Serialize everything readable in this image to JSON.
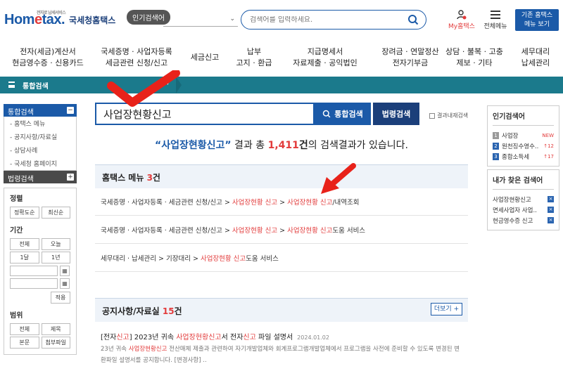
{
  "header": {
    "logo_text_left": "Hom",
    "logo_text_e": "e",
    "logo_text_right": "tax.",
    "logo_sub": "전자로 납세서비스",
    "logo_kr": "국세청홈택스",
    "hot_label": "인기검색어",
    "search_placeholder": "검색어를 입력하세요.",
    "my_hometax": "My홈택스",
    "all_menu": "전체메뉴",
    "old_home": "기존 홈택스\n메뉴 보기"
  },
  "gnb": [
    {
      "label": "전자(세금)계산서\n현금영수증 · 신용카드"
    },
    {
      "label": "국세증명 · 사업자등록\n세금관련 신청/신고"
    },
    {
      "label": "세금신고"
    },
    {
      "label": "납부\n고지 · 환급"
    },
    {
      "label": "지급명세서\n자료제출 · 공익법인"
    },
    {
      "label": "장려금 · 연말정산\n전자기부금"
    },
    {
      "label": "상담 · 불복 · 고충\n제보 · 기타"
    },
    {
      "label": "세무대리\n납세관리"
    }
  ],
  "navbar": {
    "crumb": "통합검색",
    "drop": "▾"
  },
  "sidebar": {
    "head1": "통합검색",
    "items": [
      "- 홈택스 메뉴",
      "- 공지사항/자료실",
      "- 상담사례",
      "- 국세청 홈페이지"
    ],
    "head2": "법령검색",
    "sort_title": "정렬",
    "sort_buttons": [
      "정확도순",
      "최신순"
    ],
    "period_title": "기간",
    "period_buttons": [
      "전체",
      "오늘",
      "1달",
      "1년"
    ],
    "apply": "적용",
    "scope_title": "범위",
    "scope_buttons": [
      "전체",
      "제목",
      "본문",
      "첨부파일"
    ]
  },
  "search": {
    "value": "사업장현황신고",
    "total_button": "통합검색",
    "law_button": "법령검색",
    "within_label": "결과내재검색"
  },
  "result": {
    "open_q": "“",
    "keyword": "사업장현황신고",
    "close_q": "”",
    "mid": " 결과 총 ",
    "count": "1,411",
    "unit": "건",
    "tail": "의 검색결과가 있습니다."
  },
  "menu_section": {
    "title": "홈택스 메뉴 ",
    "count": "3",
    "unit": "건",
    "rows": [
      {
        "pre": "국세증명 · 사업자등록 · 세금관련 신청/신고 > ",
        "hl1": "사업장현황 신고",
        "mid": " > ",
        "hl2": "사업장현황 신고",
        "post": "/내역조회"
      },
      {
        "pre": "국세증명 · 사업자등록 · 세금관련 신청/신고 > ",
        "hl1": "사업장현황 신고",
        "mid": " > ",
        "hl2": "사업장현황 신고",
        "post": "도움 서비스"
      },
      {
        "pre": "세무대리 · 납세관리 > 기장대리 > ",
        "hl1": "사업장현황 신고",
        "mid": "",
        "hl2": "",
        "post": "도움 서비스"
      }
    ]
  },
  "notice_section": {
    "title": "공지사항/자료실 ",
    "count": "15",
    "unit": "건",
    "more": "더보기 +",
    "item_pre": "[전자",
    "item_hl1": "신고",
    "item_mid": "] 2023년 귀속 ",
    "item_hl2": "사업장현황신고",
    "item_mid2": "서 전자",
    "item_hl3": "신고",
    "item_post": " 파일 설명서",
    "item_date": "2024.01.02",
    "body_pre": "23년 귀속 ",
    "body_hl": "사업장현황신고",
    "body_post": " 전산매체 제출과 관련하여 자기개발업체와 회계프로그램개발업체에서 프로그램을 사전에 준비할 수 있도록 변경된 변환파일 설명서를 공지합니다. [변경사항] .."
  },
  "popular": {
    "title": "인기검색어",
    "items": [
      {
        "rank": "1",
        "text": "사업장",
        "status": "NEW",
        "rank_color": "#9a9a9a"
      },
      {
        "rank": "2",
        "text": "원천징수영수..",
        "status": "↑12",
        "rank_color": "#2a64b0"
      },
      {
        "rank": "3",
        "text": "종합소득세",
        "status": "↑17",
        "rank_color": "#2a64b0"
      }
    ]
  },
  "mine": {
    "title": "내가 찾은 검색어",
    "items": [
      "사업장현황신고",
      "면세사업자 사업..",
      "현금영수증 신고"
    ],
    "remove": "×"
  }
}
